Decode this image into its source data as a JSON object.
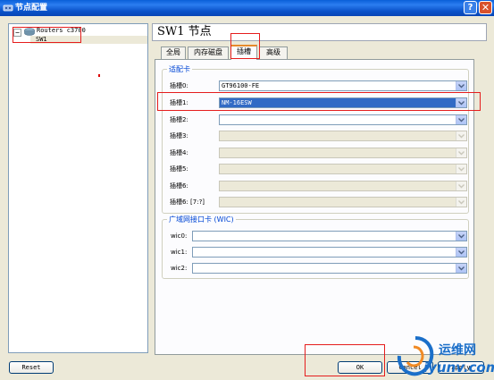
{
  "window": {
    "title": "节点配置",
    "help_glyph": "?",
    "close_glyph": "✕"
  },
  "tree": {
    "expander": "−",
    "root_label": "Routers c3700",
    "child_label": "SW1",
    "root_icon": "router-icon"
  },
  "header": {
    "title": "SW1 节点"
  },
  "tabs": [
    {
      "label": "全局",
      "active": false
    },
    {
      "label": "内存磁盘",
      "active": false
    },
    {
      "label": "插槽",
      "active": true
    },
    {
      "label": "高级",
      "active": false
    }
  ],
  "adapters": {
    "group_title": "适配卡",
    "slots": [
      {
        "label": "插槽0:",
        "value": "GT96100-FE",
        "enabled": true,
        "selected": false
      },
      {
        "label": "插槽1:",
        "value": "NM-16ESW",
        "enabled": true,
        "selected": true
      },
      {
        "label": "插槽2:",
        "value": "",
        "enabled": true,
        "selected": false
      },
      {
        "label": "插槽3:",
        "value": "",
        "enabled": false,
        "selected": false
      },
      {
        "label": "插槽4:",
        "value": "",
        "enabled": false,
        "selected": false
      },
      {
        "label": "插槽5:",
        "value": "",
        "enabled": false,
        "selected": false
      },
      {
        "label": "插槽6:",
        "value": "",
        "enabled": false,
        "selected": false
      },
      {
        "label": "插槽6: [7:?]",
        "value": "",
        "enabled": false,
        "selected": false
      }
    ]
  },
  "wic": {
    "group_title": "广域网接口卡 (WIC)",
    "slots": [
      {
        "label": "wic0:",
        "value": ""
      },
      {
        "label": "wic1:",
        "value": ""
      },
      {
        "label": "wic2:",
        "value": ""
      }
    ]
  },
  "buttons": {
    "reset": "Reset",
    "ok": "OK",
    "cancel": "Cancel",
    "apply": "Apply"
  },
  "watermark": {
    "text": "运维网",
    "url": "iyunv.com"
  },
  "colors": {
    "titlebar": "#0a52c9",
    "selection": "#316ac5",
    "annotation": "#e51d1d",
    "tab_highlight": "#e68b2c"
  }
}
